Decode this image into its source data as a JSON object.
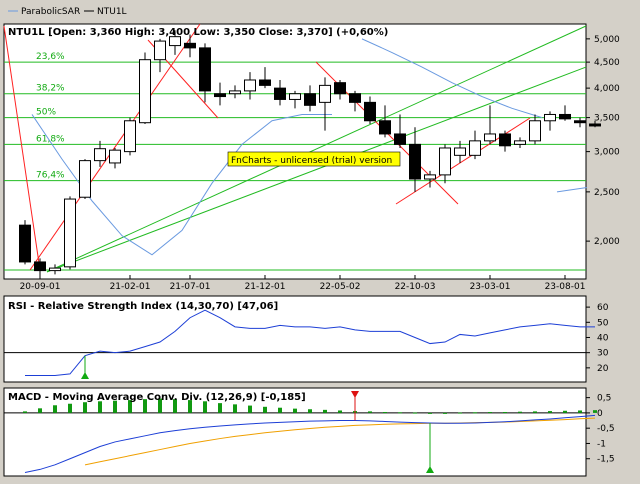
{
  "colors": {
    "panel_bg": "#ffffff",
    "frame": "#000000",
    "up_candle": "#ffffff",
    "down_candle": "#000000",
    "fib_line": "#22bb22",
    "trend_line": "#ff2222",
    "sar_line": "#6a9ae0",
    "rsi_line": "#1d3fd6",
    "macd_line": "#1d3fd6",
    "signal_line": "#f0a000",
    "histogram": "#119911",
    "buy_marker": "#11aa11",
    "sell_marker": "#dd1111",
    "watermark_bg": "#ffff00"
  },
  "legend": {
    "sar_label": "ParabolicSAR",
    "price_label": "NTU1L"
  },
  "price_panel": {
    "title": "NTU1L [Open: 3,360  High: 3,400  Low: 3,350  Close: 3,370] (+0,60%)",
    "watermark": "FnCharts - unlicensed (trial) version",
    "fib_labels": [
      "23,6%",
      "38,2%",
      "50%",
      "61,8%",
      "76,4%"
    ],
    "y_ticks": [
      "5,000",
      "4,500",
      "4,000",
      "3,500",
      "3,000",
      "2,500",
      "2,000"
    ],
    "x_ticks": [
      "20-09-01",
      "21-02-01",
      "21-07-01",
      "21-12-01",
      "22-05-02",
      "22-10-03",
      "23-03-01",
      "23-08-01"
    ]
  },
  "rsi_panel": {
    "title": "RSI - Relative Strength Index (14,30,70) [47,06]",
    "y_ticks": [
      "60",
      "50",
      "40",
      "30",
      "20"
    ]
  },
  "macd_panel": {
    "title": "MACD - Moving Average Conv. Div. (12,26,9) [-0,185]",
    "y_ticks": [
      "0,5",
      "0",
      "-0,5",
      "-1",
      "-1,5"
    ]
  },
  "chart_data": [
    {
      "type": "candlestick",
      "title": "NTU1L [Open: 3,360  High: 3,400  Low: 3,350  Close: 3,370] (+0,60%)",
      "scale": "log",
      "ylim": [
        1700,
        5300
      ],
      "x_labels": [
        "20-09-01",
        "21-02-01",
        "21-07-01",
        "21-12-01",
        "22-05-02",
        "22-10-03",
        "23-03-01",
        "23-08-01"
      ],
      "candles": [
        {
          "o": 2150,
          "h": 2200,
          "l": 1800,
          "c": 1820
        },
        {
          "o": 1820,
          "h": 1850,
          "l": 1700,
          "c": 1750
        },
        {
          "o": 1750,
          "h": 1800,
          "l": 1720,
          "c": 1770
        },
        {
          "o": 1780,
          "h": 2450,
          "l": 1760,
          "c": 2420
        },
        {
          "o": 2440,
          "h": 2900,
          "l": 2420,
          "c": 2880
        },
        {
          "o": 2880,
          "h": 3150,
          "l": 2800,
          "c": 3040
        },
        {
          "o": 2850,
          "h": 3050,
          "l": 2780,
          "c": 3020
        },
        {
          "o": 3000,
          "h": 3500,
          "l": 2950,
          "c": 3450
        },
        {
          "o": 3420,
          "h": 4700,
          "l": 3400,
          "c": 4550
        },
        {
          "o": 4550,
          "h": 5000,
          "l": 4300,
          "c": 4950
        },
        {
          "o": 4850,
          "h": 5200,
          "l": 4650,
          "c": 5050
        },
        {
          "o": 4900,
          "h": 5100,
          "l": 4600,
          "c": 4800
        },
        {
          "o": 4800,
          "h": 4900,
          "l": 3750,
          "c": 3950
        },
        {
          "o": 3900,
          "h": 4100,
          "l": 3700,
          "c": 3850
        },
        {
          "o": 3900,
          "h": 4050,
          "l": 3820,
          "c": 3950
        },
        {
          "o": 3950,
          "h": 4300,
          "l": 3800,
          "c": 4150
        },
        {
          "o": 4150,
          "h": 4400,
          "l": 4000,
          "c": 4050
        },
        {
          "o": 4000,
          "h": 4150,
          "l": 3700,
          "c": 3800
        },
        {
          "o": 3800,
          "h": 3950,
          "l": 3650,
          "c": 3900
        },
        {
          "o": 3900,
          "h": 4050,
          "l": 3600,
          "c": 3700
        },
        {
          "o": 3750,
          "h": 4200,
          "l": 3300,
          "c": 4050
        },
        {
          "o": 4100,
          "h": 4150,
          "l": 3800,
          "c": 3900
        },
        {
          "o": 3900,
          "h": 3950,
          "l": 3600,
          "c": 3750
        },
        {
          "o": 3750,
          "h": 3850,
          "l": 3400,
          "c": 3450
        },
        {
          "o": 3450,
          "h": 3700,
          "l": 3200,
          "c": 3250
        },
        {
          "o": 3250,
          "h": 3550,
          "l": 3050,
          "c": 3100
        },
        {
          "o": 3100,
          "h": 3350,
          "l": 2500,
          "c": 2650
        },
        {
          "o": 2650,
          "h": 2750,
          "l": 2550,
          "c": 2700
        },
        {
          "o": 2700,
          "h": 3100,
          "l": 2600,
          "c": 3050
        },
        {
          "o": 2950,
          "h": 3150,
          "l": 2850,
          "c": 3050
        },
        {
          "o": 2950,
          "h": 3300,
          "l": 2900,
          "c": 3150
        },
        {
          "o": 3150,
          "h": 3700,
          "l": 3100,
          "c": 3250
        },
        {
          "o": 3250,
          "h": 3300,
          "l": 3000,
          "c": 3080
        },
        {
          "o": 3100,
          "h": 3200,
          "l": 3050,
          "c": 3150
        },
        {
          "o": 3150,
          "h": 3550,
          "l": 3100,
          "c": 3450
        },
        {
          "o": 3450,
          "h": 3600,
          "l": 3300,
          "c": 3550
        },
        {
          "o": 3550,
          "h": 3700,
          "l": 3450,
          "c": 3480
        },
        {
          "o": 3450,
          "h": 3500,
          "l": 3350,
          "c": 3420
        },
        {
          "o": 3400,
          "h": 3450,
          "l": 3350,
          "c": 3370
        }
      ],
      "parabolic_sar": [
        {
          "i": 1,
          "v": 3550
        },
        {
          "i": 3,
          "v": 2900
        },
        {
          "i": 5,
          "v": 2400
        },
        {
          "i": 7,
          "v": 2050
        },
        {
          "i": 9,
          "v": 1880
        },
        {
          "i": 11,
          "v": 2100
        },
        {
          "i": 13,
          "v": 2600
        },
        {
          "i": 15,
          "v": 3100
        },
        {
          "i": 17,
          "v": 3450
        },
        {
          "i": 19,
          "v": 3550
        },
        {
          "i": 21,
          "v": 3550
        },
        {
          "i": 23,
          "v": 5000
        },
        {
          "i": 25,
          "v": 4700
        },
        {
          "i": 27,
          "v": 4400
        },
        {
          "i": 29,
          "v": 4100
        },
        {
          "i": 31,
          "v": 3850
        },
        {
          "i": 33,
          "v": 3650
        },
        {
          "i": 35,
          "v": 3500
        },
        {
          "i": 36,
          "v": 2500
        },
        {
          "i": 38,
          "v": 2550
        }
      ],
      "fibonacci_levels": [
        {
          "label": "23,6%",
          "value": 4500
        },
        {
          "label": "38,2%",
          "value": 3900
        },
        {
          "label": "50%",
          "value": 3500
        },
        {
          "label": "61,8%",
          "value": 3100
        },
        {
          "label": "76,4%",
          "value": 2630
        }
      ]
    },
    {
      "type": "line",
      "title": "RSI - Relative Strength Index (14,30,70) [47,06]",
      "ylim": [
        12,
        66
      ],
      "reference_levels": [
        30
      ],
      "values": [
        15,
        15,
        15,
        16,
        28,
        31,
        30,
        31,
        34,
        37,
        44,
        53,
        58,
        53,
        47,
        46,
        46,
        48,
        47,
        47,
        46,
        47,
        45,
        44,
        44,
        44,
        40,
        36,
        37,
        42,
        41,
        43,
        45,
        47,
        48,
        49,
        48,
        47,
        47
      ],
      "buy_signals": [
        4
      ]
    },
    {
      "type": "line",
      "title": "MACD - Moving Average Conv. Div. (12,26,9) [-0,185]",
      "ylim": [
        -2.0,
        0.75
      ],
      "series": [
        {
          "values": [
            -1.95,
            -1.85,
            -1.7,
            -1.5,
            -1.3,
            -1.1,
            -0.95,
            -0.85,
            -0.75,
            -0.65,
            -0.58,
            -0.52,
            -0.47,
            -0.43,
            -0.39,
            -0.36,
            -0.33,
            -0.31,
            -0.29,
            -0.27,
            -0.26,
            -0.25,
            -0.25,
            -0.26,
            -0.28,
            -0.3,
            -0.32,
            -0.33,
            -0.34,
            -0.34,
            -0.33,
            -0.31,
            -0.29,
            -0.26,
            -0.23,
            -0.2,
            -0.16,
            -0.12,
            -0.08
          ]
        },
        {
          "values": [
            null,
            null,
            null,
            null,
            -1.7,
            -1.6,
            -1.5,
            -1.4,
            -1.3,
            -1.2,
            -1.1,
            -1.0,
            -0.92,
            -0.84,
            -0.77,
            -0.71,
            -0.65,
            -0.6,
            -0.55,
            -0.51,
            -0.47,
            -0.44,
            -0.41,
            -0.39,
            -0.37,
            -0.36,
            -0.35,
            -0.34,
            -0.34,
            -0.33,
            -0.32,
            -0.31,
            -0.3,
            -0.28,
            -0.26,
            -0.24,
            -0.22,
            -0.19,
            -0.17
          ]
        }
      ],
      "histogram": [
        0.05,
        0.15,
        0.25,
        0.3,
        0.35,
        0.38,
        0.4,
        0.42,
        0.45,
        0.47,
        0.45,
        0.42,
        0.38,
        0.32,
        0.28,
        0.24,
        0.2,
        0.17,
        0.14,
        0.12,
        0.1,
        0.08,
        0.06,
        0.05,
        0.03,
        0.02,
        0.01,
        -0.01,
        0.0,
        0.01,
        0.02,
        0.03,
        0.03,
        0.04,
        0.05,
        0.06,
        0.07,
        0.08,
        0.09
      ],
      "sell_signals": [
        22
      ],
      "buy_signals": [
        27
      ]
    }
  ]
}
